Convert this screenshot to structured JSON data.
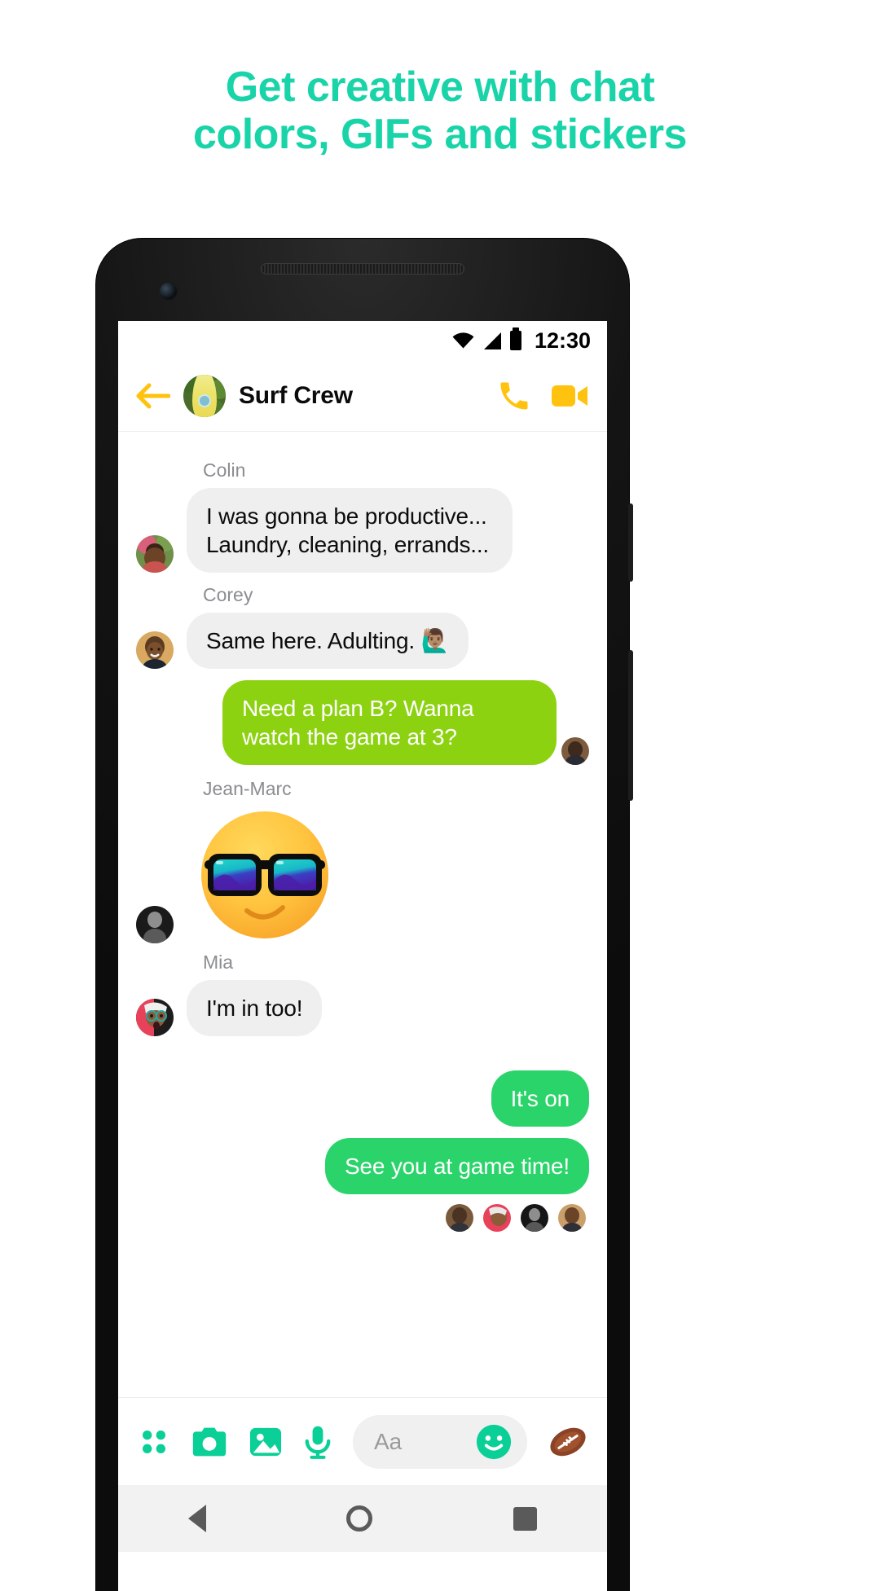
{
  "headline": {
    "line1": "Get creative with chat",
    "line2": "colors, GIFs and stickers",
    "color": "#18D4A8"
  },
  "status_bar": {
    "time": "12:30",
    "icons": [
      "wifi-icon",
      "cellular-signal-icon",
      "battery-icon"
    ]
  },
  "chat_header": {
    "back_label": "back-arrow",
    "title": "Surf Crew",
    "avatar_alt": "surfboard-group-photo",
    "call_label": "voice-call",
    "video_label": "video-call",
    "accent_color": "#FFC20E"
  },
  "thread": {
    "messages": [
      {
        "sender": "Colin",
        "text": "I was gonna be productive... Laundry, cleaning, errands...",
        "side": "in",
        "style": "grey"
      },
      {
        "sender": "Corey",
        "text": "Same here. Adulting. 🙋🏽‍♂️",
        "side": "in",
        "style": "grey"
      },
      {
        "sender": "",
        "text": "Need a plan B? Wanna watch the game at 3?",
        "side": "out",
        "style": "lime"
      },
      {
        "sender": "Jean-Marc",
        "text": "",
        "side": "in",
        "style": "sticker",
        "sticker": "sunglasses-smiley-sticker"
      },
      {
        "sender": "Mia",
        "text": "I'm in too!",
        "side": "in",
        "style": "grey"
      },
      {
        "sender": "",
        "text": "It's on",
        "side": "out",
        "style": "green"
      },
      {
        "sender": "",
        "text": "See you at game time!",
        "side": "out",
        "style": "green"
      }
    ],
    "seen_by_count": 4,
    "colors": {
      "incoming_bubble": "#EFEFEF",
      "lime_bubble": "#8CD211",
      "green_bubble": "#2BD46A",
      "sender_name": "#8A8D91"
    }
  },
  "composer": {
    "placeholder": "Aa",
    "icons": [
      "four-dot-grid-icon",
      "camera-icon",
      "gallery-icon",
      "microphone-icon"
    ],
    "emoji_button": "smiley-icon",
    "send_sticker": "football-icon",
    "accent_color": "#0ACF97"
  },
  "nav_bar": {
    "back": "triangle-back-icon",
    "home": "circle-home-icon",
    "recents": "square-recents-icon"
  }
}
